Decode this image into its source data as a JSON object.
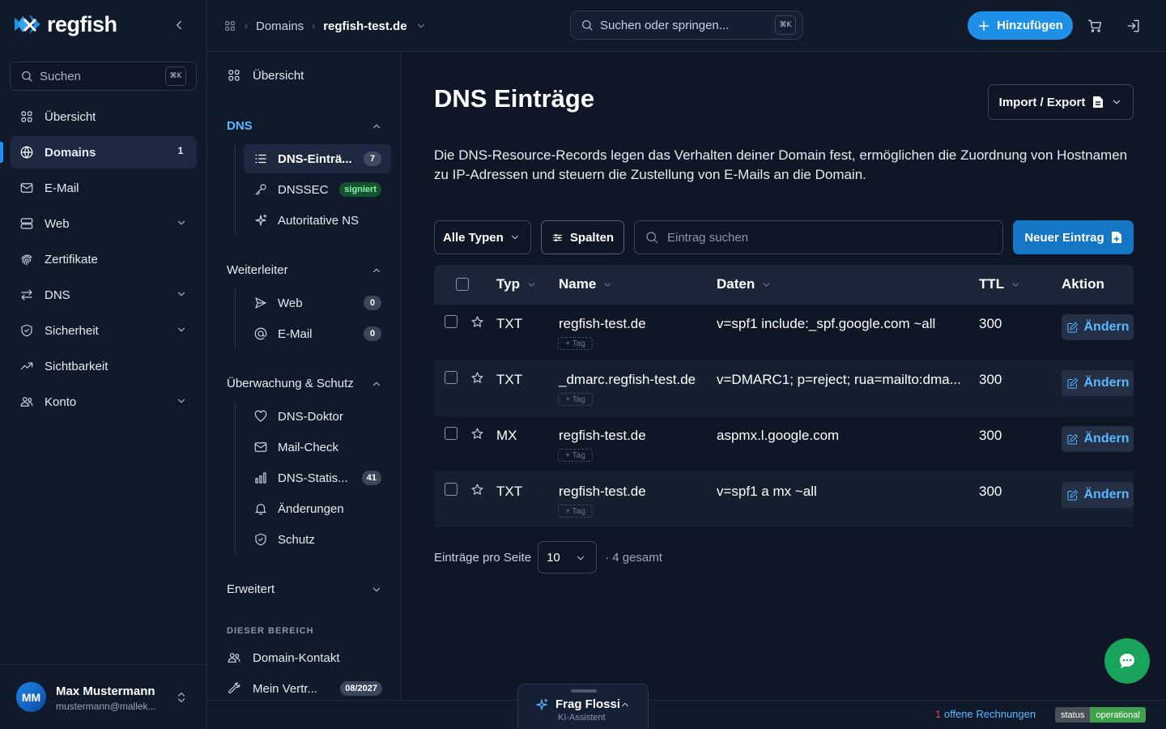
{
  "brand": {
    "name": "regfish"
  },
  "sidebar": {
    "search_placeholder": "Suchen",
    "search_shortcut": "⌘K",
    "items": [
      {
        "label": "Übersicht",
        "icon": "grid-icon"
      },
      {
        "label": "Domains",
        "icon": "globe-icon",
        "badge": "1",
        "active": true
      },
      {
        "label": "E-Mail",
        "icon": "mail-icon"
      },
      {
        "label": "Web",
        "icon": "server-icon",
        "expandable": true
      },
      {
        "label": "Zertifikate",
        "icon": "fingerprint-icon"
      },
      {
        "label": "DNS",
        "icon": "arrows-icon",
        "expandable": true
      },
      {
        "label": "Sicherheit",
        "icon": "shield-icon",
        "expandable": true
      },
      {
        "label": "Sichtbarkeit",
        "icon": "trend-icon"
      },
      {
        "label": "Konto",
        "icon": "users-icon",
        "expandable": true
      }
    ],
    "user": {
      "initials": "MM",
      "name": "Max Mustermann",
      "email": "mustermann@mallek..."
    }
  },
  "topbar": {
    "breadcrumb": [
      "Domains",
      "regfish-test.de"
    ],
    "search_placeholder": "Suchen oder springen...",
    "search_shortcut": "⌘K",
    "add_label": "Hinzufügen"
  },
  "subnav": {
    "overview": "Übersicht",
    "dns_group": "DNS",
    "dns_items": [
      {
        "label": "DNS-Einträ...",
        "badge": "7"
      },
      {
        "label": "DNSSEC",
        "badge": "signiert"
      },
      {
        "label": "Autoritative NS"
      }
    ],
    "forward_group": "Weiterleiter",
    "forward_items": [
      {
        "label": "Web",
        "badge": "0"
      },
      {
        "label": "E-Mail",
        "badge": "0"
      }
    ],
    "monitor_group": "Überwachung & Schutz",
    "monitor_items": [
      {
        "label": "DNS-Doktor"
      },
      {
        "label": "Mail-Check"
      },
      {
        "label": "DNS-Statis...",
        "badge": "41"
      },
      {
        "label": "Änderungen"
      },
      {
        "label": "Schutz"
      }
    ],
    "advanced_group": "Erweitert",
    "section_label": "DIESER BEREICH",
    "section_items": [
      {
        "label": "Domain-Kontakt"
      },
      {
        "label": "Mein Vertr...",
        "badge": "08/2027"
      }
    ]
  },
  "main": {
    "title": "DNS Einträge",
    "import_export": "Import / Export",
    "description": "Die DNS-Resource-Records legen das Verhalten deiner Domain fest, ermöglichen die Zuordnung von Hostnamen zu IP-Adressen und steuern die Zustellung von E-Mails an die Domain.",
    "filter_type": "Alle Typen",
    "columns_btn": "Spalten",
    "search_placeholder": "Eintrag suchen",
    "new_entry": "Neuer Eintrag",
    "table": {
      "headers": [
        "Typ",
        "Name",
        "Daten",
        "TTL",
        "Aktion"
      ],
      "rows": [
        {
          "type": "TXT",
          "name": "regfish-test.de",
          "data": "v=spf1 include:_spf.google.com ~all",
          "ttl": "300",
          "tag": "+ Tag",
          "action": "Ändern"
        },
        {
          "type": "TXT",
          "name": "_dmarc.regfish-test.de",
          "data": "v=DMARC1; p=reject; rua=mailto:dma...",
          "ttl": "300",
          "tag": "+ Tag",
          "action": "Ändern"
        },
        {
          "type": "MX",
          "name": "regfish-test.de",
          "data": "aspmx.l.google.com",
          "ttl": "300",
          "tag": "+ Tag",
          "action": "Ändern"
        },
        {
          "type": "TXT",
          "name": "regfish-test.de",
          "data": "v=spf1 a mx ~all",
          "ttl": "300",
          "tag": "+ Tag",
          "action": "Ändern"
        }
      ]
    },
    "pager": {
      "label": "Einträge pro Seite",
      "value": "10",
      "total": "· 4 gesamt"
    }
  },
  "footer": {
    "assistant_title": "Frag Flossi",
    "assistant_sub": "KI-Assistent",
    "invoice_count": "1",
    "invoice_text": " offene Rechnungen",
    "status_key": "status",
    "status_value": "operational"
  },
  "colors": {
    "accent": "#1e90e8",
    "primary_button": "#1476c4",
    "link": "#5cb8ff",
    "status_ok": "#3fa34d",
    "chat": "#1aa35a"
  }
}
